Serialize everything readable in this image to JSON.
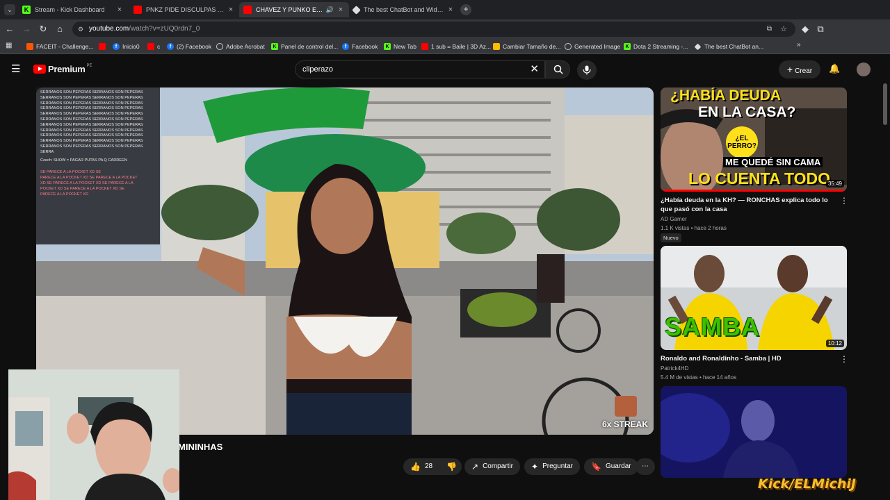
{
  "tabs": [
    {
      "title": "Stream - Kick Dashboard",
      "favicon": "kick-icon",
      "active": false
    },
    {
      "title": "PNKZ PIDE DISCULPAS A SU FA",
      "favicon": "youtube-icon",
      "active": false
    },
    {
      "title": "CHAVEZ Y PUNKO ENCUEN",
      "favicon": "youtube-icon",
      "active": true
    },
    {
      "title": "The best ChatBot and Widget",
      "favicon": "botrix-icon",
      "active": false
    }
  ],
  "address": {
    "host": "youtube.com",
    "path": "/watch?v=zUQ0rdn7_0"
  },
  "bookmarks": [
    {
      "label": "FACEIT - Challenge...",
      "icon": "faceit-icon"
    },
    {
      "label": "",
      "icon": "youtube-icon"
    },
    {
      "label": "Inicio0",
      "icon": "facebook-icon"
    },
    {
      "label": "c",
      "icon": "youtube-icon"
    },
    {
      "label": "(2) Facebook",
      "icon": "facebook-icon"
    },
    {
      "label": "Adobe Acrobat",
      "icon": "globe-icon"
    },
    {
      "label": "Panel de control del...",
      "icon": "kick-icon"
    },
    {
      "label": "Facebook",
      "icon": "facebook-icon"
    },
    {
      "label": "New Tab",
      "icon": "kick-icon"
    },
    {
      "label": "1 sub = Baile | 3D Az...",
      "icon": "youtube-icon"
    },
    {
      "label": "Cambiar Tamaño de...",
      "icon": "google-icon"
    },
    {
      "label": "Generated Image",
      "icon": "globe-icon"
    },
    {
      "label": "Dota 2 Streaming -...",
      "icon": "kick-icon"
    },
    {
      "label": "The best ChatBot an...",
      "icon": "botrix-icon"
    }
  ],
  "yt": {
    "logo_text": "Premium",
    "logo_region": "PE",
    "search_value": "cliperazo",
    "create_label": "Crear"
  },
  "chat_overlay": {
    "spam_line": "SERRANOS SON PEPERAS SERRANOS SON PEPERAS",
    "spam_tail": "SERRA",
    "czech_line": "Czech: SHOW = PAGAR PUTAS PA Q CARREEN",
    "pocket_lines": [
      "SE PARECE A LA POCKET XD  SE",
      "PARECE A LA POCKET XD  SE PARECE A LA POCKET",
      "XD  SE PARECE A LA POCKET XD  SE PARECE A LA",
      "POCKET XD  SE PARECE A LA POCKET XD  SE",
      "PARECE A LA POCKET XD"
    ]
  },
  "video": {
    "title_partial": "MININHAS",
    "streak": "6x STREAK",
    "likes": "28",
    "share_label": "Compartir",
    "ask_label": "Preguntar",
    "save_label": "Guardar"
  },
  "recommendations": [
    {
      "thumb_line1": "¿HABÍA DEUDA",
      "thumb_line2": "EN LA CASA?",
      "thumb_bubble": "¿EL PERRO?",
      "thumb_line3": "ME QUEDÉ SIN CAMA",
      "thumb_line4": "LO CUENTA TODO",
      "duration": "35:49",
      "title": "¿Había deuda en la KH? — RONCHAS explica todo lo que pasó con la casa",
      "channel": "AD Gamer",
      "meta": "1.1 K vistas • hace 2 horas",
      "badge": "Nuevo"
    },
    {
      "thumb_text": "SAMBA",
      "duration": "10:12",
      "title": "Ronaldo and Ronaldinho - Samba | HD",
      "channel": "Patrick4HD",
      "meta": "5.4 M de vistas • hace 14 años"
    },
    {
      "thumb_text": "",
      "duration": ""
    }
  ],
  "watermark": "Kick/ELMichiJ"
}
